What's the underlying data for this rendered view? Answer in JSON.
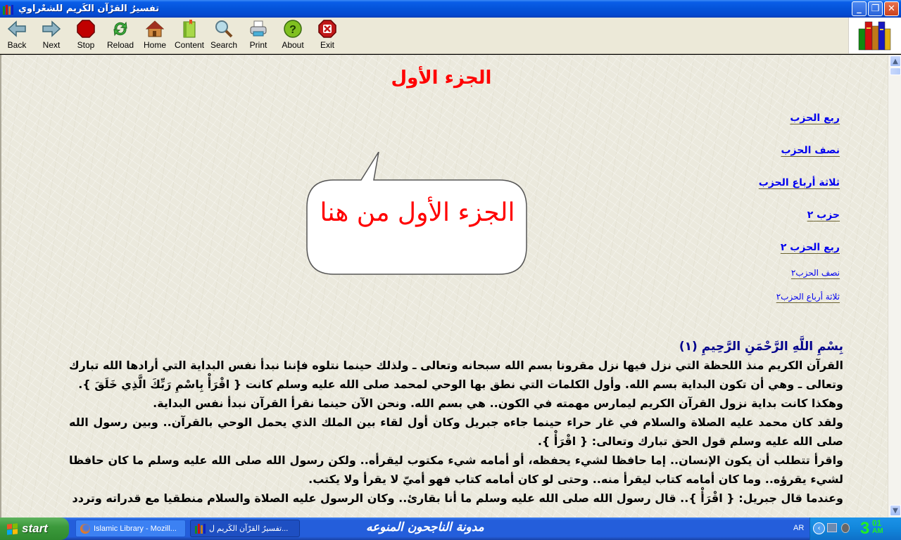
{
  "window": {
    "title": "تفسيرُ القرْآن الكَريم للشعْراوي",
    "controls": {
      "minimize": "_",
      "restore": "❐",
      "close": "✕"
    }
  },
  "toolbar": {
    "buttons": [
      {
        "label": "Back",
        "icon": "back-arrow-icon"
      },
      {
        "label": "Next",
        "icon": "next-arrow-icon"
      },
      {
        "label": "Stop",
        "icon": "stop-icon"
      },
      {
        "label": "Reload",
        "icon": "reload-icon"
      },
      {
        "label": "Home",
        "icon": "home-icon"
      },
      {
        "label": "Content",
        "icon": "book-icon"
      },
      {
        "label": "Search",
        "icon": "magnifier-icon"
      },
      {
        "label": "Print",
        "icon": "printer-icon"
      },
      {
        "label": "About",
        "icon": "help-icon"
      },
      {
        "label": "Exit",
        "icon": "exit-icon"
      }
    ],
    "logo": "books-logo-icon"
  },
  "page": {
    "heading": "الجزء الأول",
    "hizb_links": [
      "ربع الحزب",
      "نصف الحزب",
      "ثلاثة أرباع الحزب",
      "حزب ٢",
      "ربع الحزب ٢",
      "نصف الحزب٢",
      "ثلاثة أرباع الحزب٢"
    ],
    "callout": "الجزء الأول من هنا",
    "basmala": "بِسْمِ اللَّهِ الرَّحْمَنِ الرَّحِيمِ (١)",
    "paragraphs": [
      "القرآن الكريم منذ اللحظة التي نزل فيها نزل مقرونا بسم الله سبحانه وتعالى ـ ولذلك حينما نتلوه فإننا نبدأ نفس البداية التي أرادها الله تبارك وتعالى ـ وهي أن تكون البداية بسم الله. وأول الكلمات التي نطق بها الوحي لمحمد صلى الله عليه وسلم كانت { اقْرَأْ بِاسْمِ رَبِّكَ الَّذِي خَلَقَ }.",
      "وهكذا كانت بداية نزول القرآن الكريم ليمارس مهمته في الكون.. هي بسم الله. ونحن الآن حينما نقرأ القرآن نبدأ نفس البداية.",
      "ولقد كان محمد عليه الصلاة والسلام في غار حراء حينما جاءه جبريل وكان أول لقاء بين الملك الذي يحمل الوحي بالقرآن.. وبين رسول الله صلى الله عليه وسلم قول الحق تبارك وتعالى: { اقْرَأْ }.",
      "واقرأ تتطلب أن يكون الإنسان.. إما حافظا لشيء يحفظه، أو أمامه شيء مكتوب ليقرأه.. ولكن رسول الله صلى الله عليه وسلم ما كان حافظا لشيء يقرؤه.. وما كان أمامه كتاب ليقرأ منه.. وحتى لو كان أمامه كتاب فهو أميّ لا يقرأ ولا يكتب.",
      "وعندما قال جبريل: { اقْرَأْ }.. قال رسول الله صلى الله عليه وسلم ما أنا بقارئ.. وكان الرسول عليه الصلاة والسلام منطقيا مع قدراته وتردد"
    ]
  },
  "taskbar": {
    "start_label": "start",
    "tasks": [
      {
        "label": "Islamic Library - Mozill...",
        "active": false
      },
      {
        "label": "...تفسيرُ القرْآن الكَريم ل",
        "active": true
      }
    ],
    "banner": "مدونة الناجحون المنوعه",
    "language": "AR",
    "clock_hour": "3",
    "clock_min": "01",
    "clock_ampm": "AM"
  }
}
